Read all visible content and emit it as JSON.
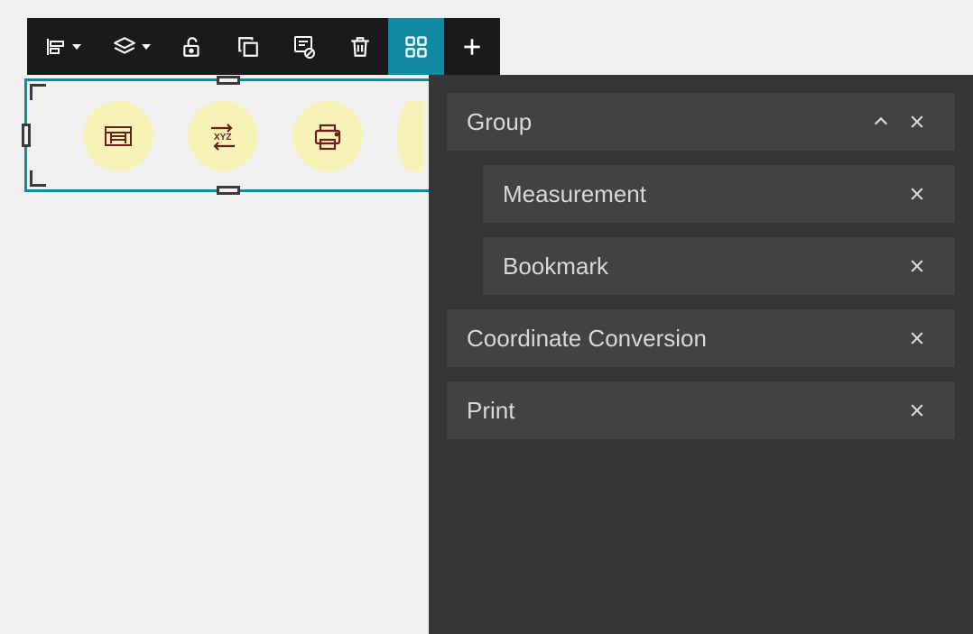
{
  "toolbar": {
    "buttons": [
      {
        "name": "align",
        "interactable": true
      },
      {
        "name": "layer",
        "interactable": true
      },
      {
        "name": "lock",
        "interactable": true
      },
      {
        "name": "duplicate",
        "interactable": true
      },
      {
        "name": "hide",
        "interactable": true
      },
      {
        "name": "delete",
        "interactable": true
      },
      {
        "name": "manage-widgets",
        "interactable": true,
        "active": true
      },
      {
        "name": "add",
        "interactable": true
      }
    ]
  },
  "selection": {
    "widgets": [
      {
        "icon": "measurement-icon"
      },
      {
        "icon": "coordinate-conversion-icon"
      },
      {
        "icon": "print-icon"
      },
      {
        "icon": "partial-icon"
      }
    ]
  },
  "panel": {
    "group_label": "Group",
    "group_children": [
      {
        "label": "Measurement"
      },
      {
        "label": "Bookmark"
      }
    ],
    "items": [
      {
        "label": "Coordinate Conversion"
      },
      {
        "label": "Print"
      }
    ]
  }
}
